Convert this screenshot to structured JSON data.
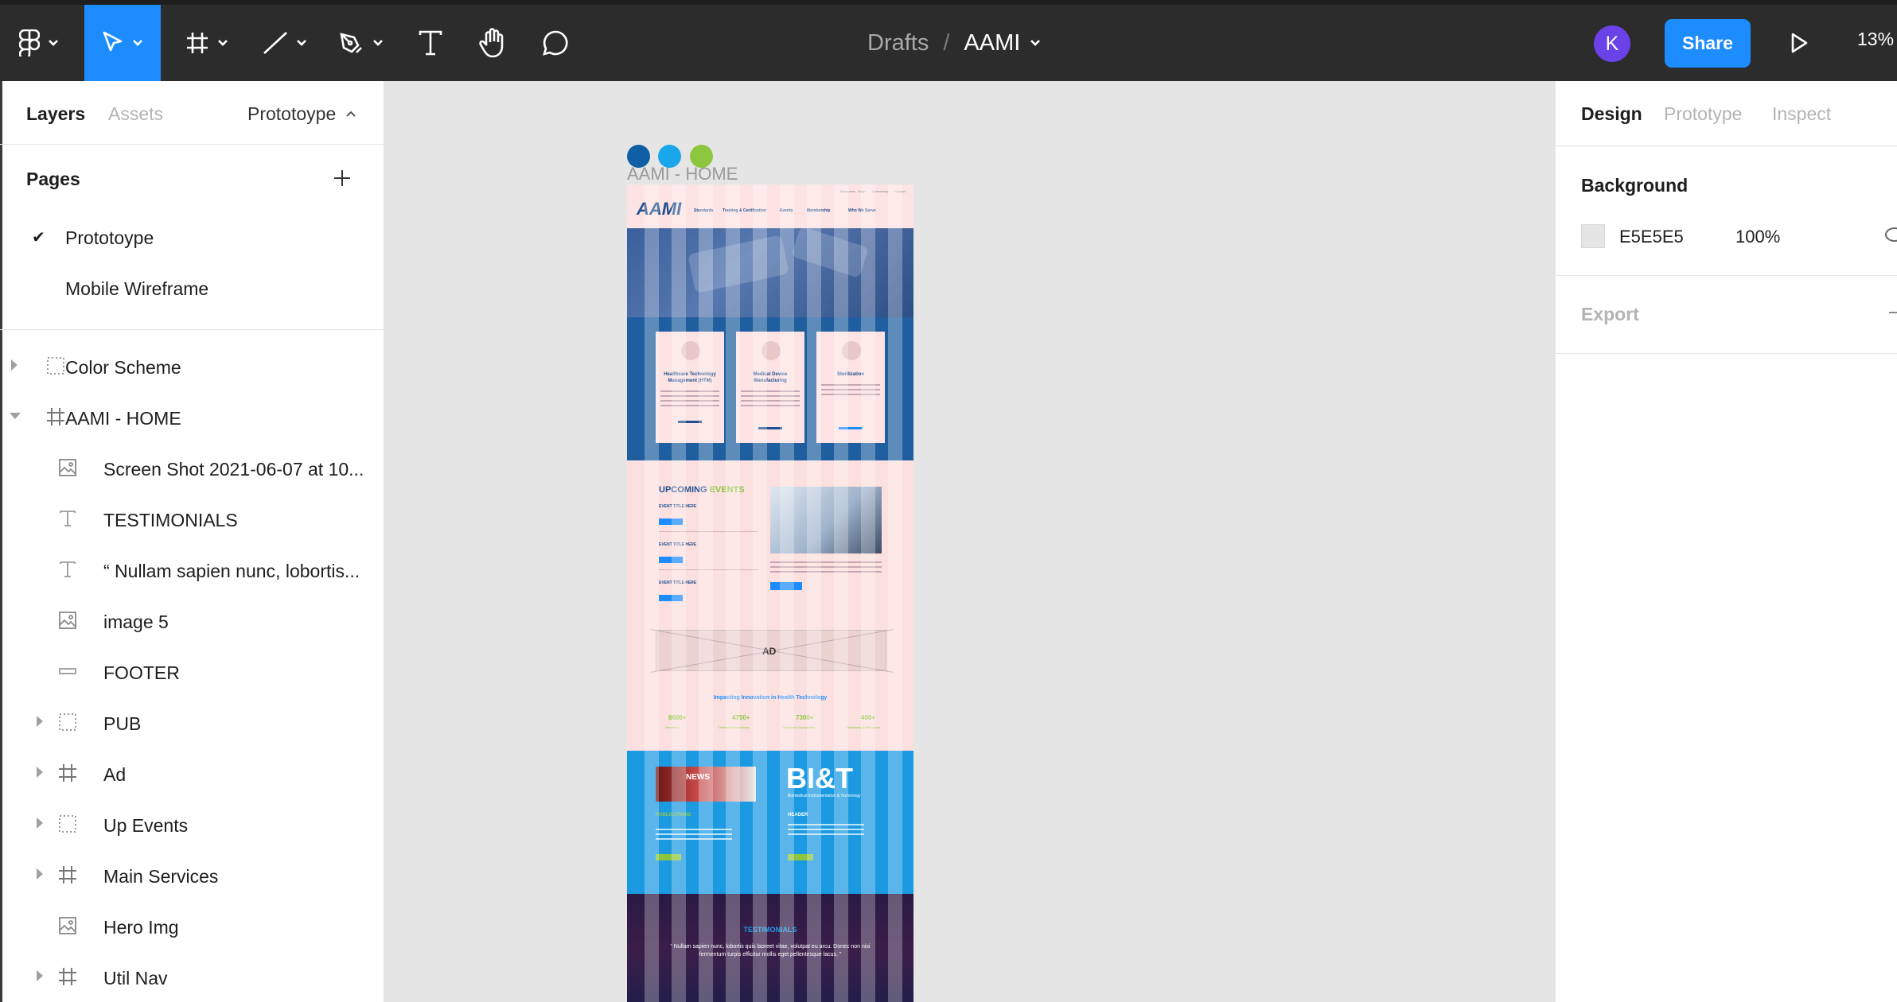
{
  "toolbar": {
    "tools": [
      "figma-menu",
      "move",
      "frame",
      "line",
      "pen",
      "text",
      "hand",
      "comment"
    ],
    "breadcrumb": {
      "folder": "Drafts",
      "separator": "/",
      "file": "AAMI"
    },
    "avatar_initial": "K",
    "share_label": "Share",
    "zoom": "13%"
  },
  "left_panel": {
    "tabs": {
      "layers": "Layers",
      "assets": "Assets",
      "page_switch": "Prototoype"
    },
    "pages_header": "Pages",
    "pages": [
      {
        "label": "Prototoype",
        "selected": true
      },
      {
        "label": "Mobile Wireframe",
        "selected": false
      }
    ],
    "layers": [
      {
        "label": "Color Scheme",
        "icon": "group-icon",
        "arrow": "right",
        "indent": 0
      },
      {
        "label": "AAMI - HOME",
        "icon": "frame-icon",
        "arrow": "down",
        "indent": 0
      },
      {
        "label": "Screen Shot 2021-06-07 at 10...",
        "icon": "image-icon",
        "arrow": "",
        "indent": 1
      },
      {
        "label": "TESTIMONIALS",
        "icon": "text-icon",
        "arrow": "",
        "indent": 1
      },
      {
        "label": "“ Nullam sapien nunc, lobortis...",
        "icon": "text-icon",
        "arrow": "",
        "indent": 1
      },
      {
        "label": "image 5",
        "icon": "image-icon",
        "arrow": "",
        "indent": 1
      },
      {
        "label": "FOOTER",
        "icon": "rectangle-icon",
        "arrow": "",
        "indent": 1
      },
      {
        "label": "PUB",
        "icon": "group-icon",
        "arrow": "right",
        "indent": 1
      },
      {
        "label": "Ad",
        "icon": "frame-icon",
        "arrow": "right",
        "indent": 1
      },
      {
        "label": "Up Events",
        "icon": "group-icon",
        "arrow": "right",
        "indent": 1
      },
      {
        "label": "Main Services",
        "icon": "frame-icon",
        "arrow": "right",
        "indent": 1
      },
      {
        "label": "Hero Img",
        "icon": "image-icon",
        "arrow": "",
        "indent": 1
      },
      {
        "label": "Util Nav",
        "icon": "frame-icon",
        "arrow": "right",
        "indent": 1
      }
    ]
  },
  "right_panel": {
    "tabs": {
      "design": "Design",
      "prototype": "Prototype",
      "inspect": "Inspect"
    },
    "background_title": "Background",
    "background_hex": "E5E5E5",
    "background_opacity": "100%",
    "export_title": "Export"
  },
  "canvas": {
    "color_dots": [
      "#0e5fa6",
      "#1aa6ea",
      "#8cc63f"
    ],
    "frame_label": "AAMI - HOME",
    "mock": {
      "logo": "AAMI",
      "nav_items": [
        "Standards",
        "Training & Certification",
        "Events",
        "Membership",
        "Who We Serve"
      ],
      "util_items": [
        "Resources",
        "Shop",
        "Community",
        "Contact"
      ],
      "cards": [
        {
          "title": "Healthcare Technology Management (HTM)",
          "button": "READ MORE"
        },
        {
          "title": "Medical Device Manufacturing",
          "button": "READ MORE"
        },
        {
          "title": "Sterilization",
          "button": "READ MORE"
        }
      ],
      "events_title_a": "UPCOMING",
      "events_title_b": "EVENTS",
      "event_items": [
        "EVENT TITLE HERE",
        "EVENT TITLE HERE",
        "EVENT TITLE HERE"
      ],
      "ad_label": "AD",
      "impact_title": "Impacting Innovation in Health Technology",
      "stats": [
        {
          "value": "8600+",
          "label": "Members"
        },
        {
          "value": "4750+",
          "label": "Certified Professionals"
        },
        {
          "value": "7300+",
          "label": "Standards Participants"
        },
        {
          "value": "400+",
          "label": "Standards & Resources"
        }
      ],
      "news_label": "NEWS",
      "bit_logo": "BI&T",
      "bit_sub": "Biomedical Instrumentation & Technology",
      "bit_left_header": "PUBLICATIONS",
      "bit_right_header": "HEADER",
      "testimonials_title": "TESTIMONIALS",
      "testimonial_quote": "“ Nullam sapien nunc, lobortis quis laoreet vitae, volutpat eu arcu. Donec non nisi fermentum turpis efficitur mollis eget pellentesque lacus. ”"
    }
  }
}
